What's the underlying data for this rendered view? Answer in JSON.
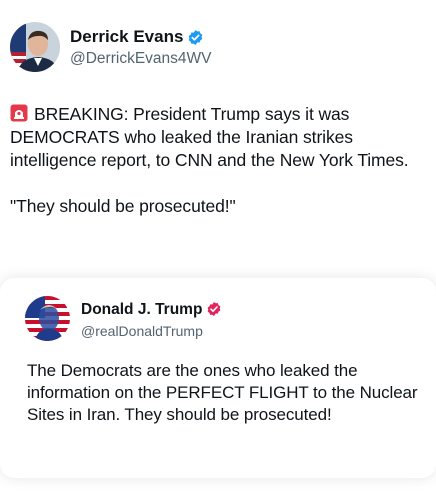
{
  "tweet": {
    "author": {
      "display_name": "Derrick Evans",
      "handle": "@DerrickEvans4WV",
      "verified_color": "#1d9bf0"
    },
    "siren_icon": "police-car-light-icon",
    "text_line1": "BREAKING: President Trump says it was DEMOCRATS who leaked the Iranian strikes intelligence report, to CNN and the New York Times.",
    "text_line2": "\"They should be prosecuted!\""
  },
  "quote": {
    "author": {
      "display_name": "Donald J. Trump",
      "handle": "@realDonaldTrump",
      "verified_color": "#e0245e"
    },
    "text": "The Democrats are the ones who leaked the information on the PERFECT FLIGHT to the Nuclear Sites in Iran. They should be prosecuted!"
  }
}
